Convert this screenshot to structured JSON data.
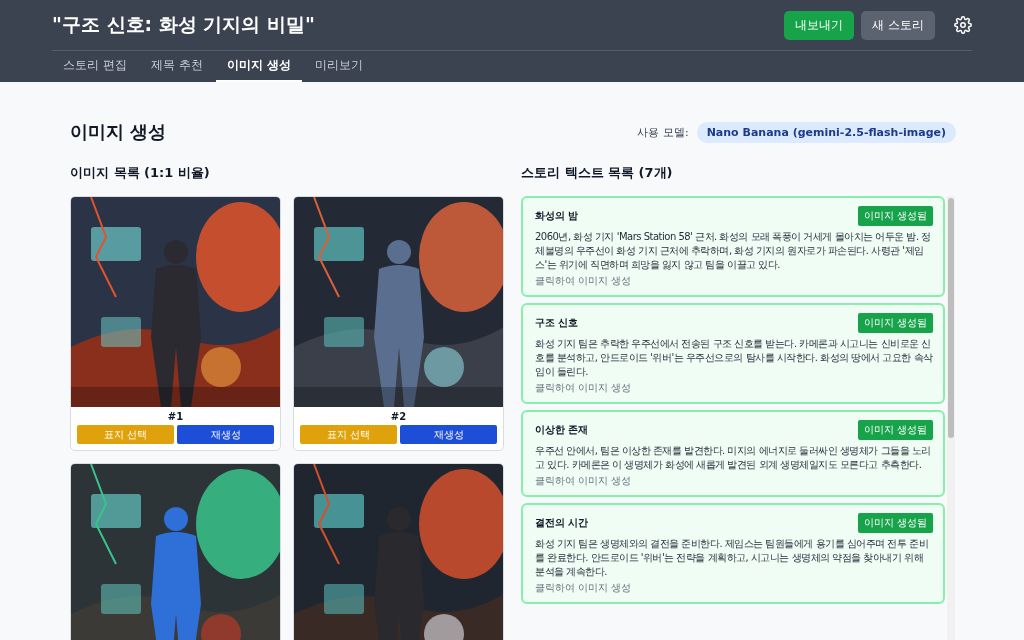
{
  "header": {
    "title": "\"구조 신호: 화성 기지의 비밀\"",
    "buttons": [
      {
        "label": "내보내기",
        "kind": "primary"
      },
      {
        "label": "새 스토리",
        "kind": "secondary"
      }
    ]
  },
  "tabs": [
    {
      "label": "스토리 편집",
      "selected": false
    },
    {
      "label": "제목 추천",
      "selected": false
    },
    {
      "label": "이미지 생성",
      "selected": true
    },
    {
      "label": "미리보기",
      "selected": false
    }
  ],
  "page": {
    "title": "이미지 생성",
    "model_label": "사용 모델:",
    "model": "Nano Banana (gemini-2.5-flash-image)"
  },
  "images": {
    "title": "이미지 목록 (1:1 비율)",
    "items": [
      {
        "kind": "picture",
        "number": "#1",
        "cover_button": "표지 선택",
        "regenerate_button": "재생성"
      },
      {
        "kind": "picture",
        "number": "#2",
        "cover_button": "표지 선택",
        "regenerate_button": "재생성"
      },
      {
        "kind": "picture"
      },
      {
        "kind": "picture"
      }
    ]
  },
  "stories": {
    "title": "스토리 텍스트 목록 (7개)",
    "items": [
      {
        "title": "화성의 밤",
        "badge": "이미지 생성됨",
        "text": "2060년, 화성 기지 'Mars Station 58' 근처. 화성의 모래 폭풍이 거세게 몰아치는 어두운 밤. 정체불명의 우주선이 화성 기지 근처에 추락하며, 화성 기지의 원자로가 파손된다. 사령관 '제임스'는 위기에 직면하며 희망을 잃지 않고 팀을 이끌고 있다.",
        "hint": "클릭하여 이미지 생성"
      },
      {
        "title": "구조 신호",
        "badge": "이미지 생성됨",
        "text": "화성 기지 팀은 추락한 우주선에서 전송된 구조 신호를 받는다. 카메론과 시고니는 신비로운 신호를 분석하고, 안드로이드 '위버'는 우주선으로의 탐사를 시작한다. 화성의 땅에서 고요한 속삭임이 들린다.",
        "hint": "클릭하여 이미지 생성"
      },
      {
        "title": "이상한 존재",
        "badge": "이미지 생성됨",
        "text": "우주선 안에서, 팀은 이상한 존재를 발견한다. 미지의 에너지로 둘러싸인 생명체가 그들을 노리고 있다. 카메론은 이 생명체가 화성에 새롭게 발견된 외계 생명체일지도 모른다고 추측한다.",
        "hint": "클릭하여 이미지 생성"
      },
      {
        "title": "결전의 시간",
        "badge": "이미지 생성됨",
        "text": "화성 기지 팀은 생명체와의 결전을 준비한다. 제임스는 팀원들에게 용기를 심어주며 전투 준비를 완료한다. 안드로이드 '위버'는 전략을 계획하고, 시고니는 생명체의 약점을 찾아내기 위해 분석을 계속한다.",
        "hint": "클릭하여 이미지 생성"
      }
    ]
  }
}
